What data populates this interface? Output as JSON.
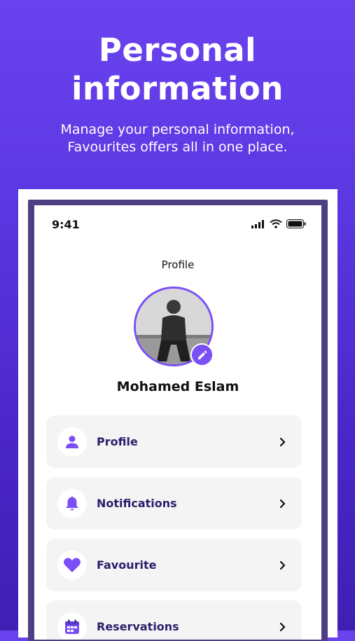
{
  "hero": {
    "title_line1": "Personal",
    "title_line2": "information",
    "subtitle_line1": "Manage your personal information,",
    "subtitle_line2": "Favourites offers all in one place."
  },
  "status_bar": {
    "time": "9:41"
  },
  "screen": {
    "title": "Profile"
  },
  "user": {
    "name": "Mohamed Eslam"
  },
  "menu": {
    "items": [
      {
        "label": "Profile",
        "icon": "person-icon"
      },
      {
        "label": "Notifications",
        "icon": "bell-icon"
      },
      {
        "label": "Favourite",
        "icon": "heart-icon"
      },
      {
        "label": "Reservations",
        "icon": "calendar-icon"
      }
    ]
  },
  "colors": {
    "accent": "#7a4ff5",
    "label": "#2b1f6b",
    "background": "#5a36e0"
  }
}
